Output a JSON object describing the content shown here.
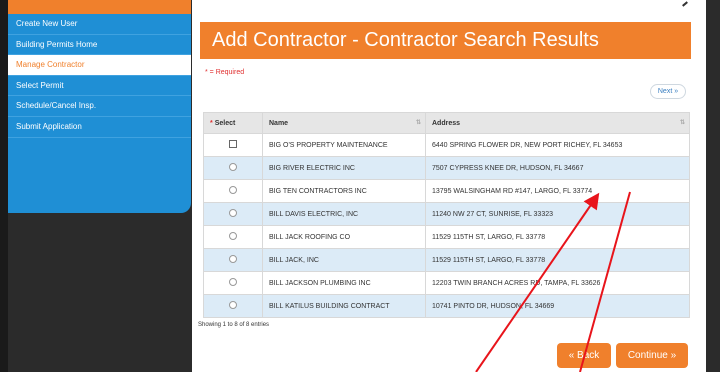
{
  "sidebar": {
    "items": [
      {
        "label": "Create New User",
        "active": false
      },
      {
        "label": "Building Permits Home",
        "active": false
      },
      {
        "label": "Manage Contractor",
        "active": true
      },
      {
        "label": "Select Permit",
        "active": false
      },
      {
        "label": "Schedule/Cancel Insp.",
        "active": false
      },
      {
        "label": "Submit Application",
        "active": false
      }
    ]
  },
  "page": {
    "title": "Add Contractor - Contractor Search Results",
    "required_note": "* = Required",
    "next_label": "Next »",
    "entries_text": "Showing 1 to 8 of 8 entries",
    "back_label": "« Back",
    "continue_label": "Continue »"
  },
  "table": {
    "columns": {
      "select": "Select",
      "select_required": "*",
      "name": "Name",
      "address": "Address"
    },
    "rows": [
      {
        "name": "BIG O'S PROPERTY MAINTENANCE",
        "address": "6440 SPRING FLOWER DR, NEW PORT RICHEY, FL 34653"
      },
      {
        "name": "BIG RIVER ELECTRIC INC",
        "address": "7507 CYPRESS KNEE DR, HUDSON, FL 34667"
      },
      {
        "name": "BIG TEN CONTRACTORS INC",
        "address": "13795 WALSINGHAM RD #147, LARGO, FL 33774"
      },
      {
        "name": "BILL DAVIS ELECTRIC, INC",
        "address": "11240 NW 27 CT, SUNRISE, FL 33323"
      },
      {
        "name": "BILL JACK ROOFING CO",
        "address": "11529 115TH ST, LARGO, FL 33778"
      },
      {
        "name": "BILL JACK, INC",
        "address": "11529 115TH ST, LARGO, FL 33778"
      },
      {
        "name": "BILL JACKSON PLUMBING INC",
        "address": "12203 TWIN BRANCH ACRES RD, TAMPA, FL 33626"
      },
      {
        "name": "BILL KATILUS BUILDING CONTRACT",
        "address": "10741 PINTO DR, HUDSON, FL 34669"
      }
    ]
  },
  "colors": {
    "accent": "#f0802c",
    "sidebar": "#1f8fd5",
    "annotation": "#e8141b"
  }
}
